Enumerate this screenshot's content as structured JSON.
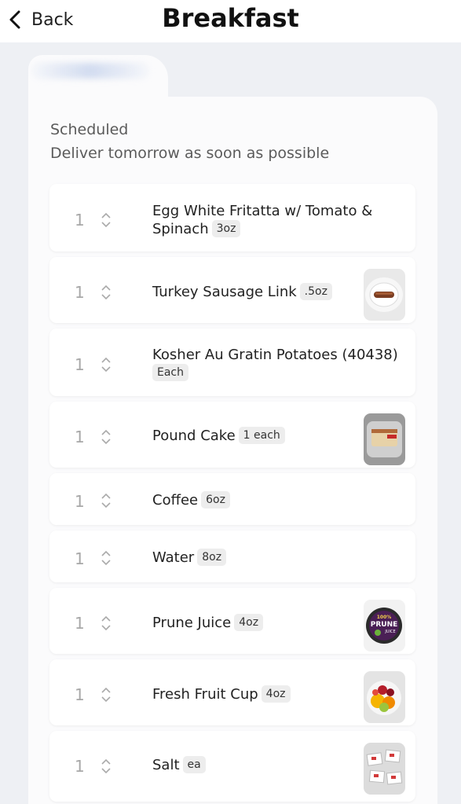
{
  "header": {
    "back_label": "Back",
    "title": "Breakfast"
  },
  "schedule": {
    "label": "Scheduled",
    "subtitle": "Deliver tomorrow as soon as possible"
  },
  "items": [
    {
      "qty": "1",
      "name": "Egg White Fritatta w/ Tomato &",
      "name2": "Spinach",
      "portion": "3oz",
      "image": null
    },
    {
      "qty": "1",
      "name": "Turkey Sausage Link",
      "portion": ".5oz",
      "image": "sausage-photo"
    },
    {
      "qty": "1",
      "name": "Kosher Au Gratin Potatoes (40438)",
      "portion": "Each",
      "image": null
    },
    {
      "qty": "1",
      "name": "Pound Cake",
      "portion": "1 each",
      "image": "pound-cake-photo"
    },
    {
      "qty": "1",
      "name": "Coffee",
      "portion": "6oz",
      "image": null
    },
    {
      "qty": "1",
      "name": "Water",
      "portion": "8oz",
      "image": null
    },
    {
      "qty": "1",
      "name": "Prune Juice",
      "portion": "4oz",
      "image": "prune-juice-photo",
      "image_label": "100% PRUNE JUICE"
    },
    {
      "qty": "1",
      "name": "Fresh Fruit Cup",
      "portion": "4oz",
      "image": "fruit-cup-photo"
    },
    {
      "qty": "1",
      "name": "Salt",
      "portion": "ea",
      "image": "salt-packets-photo"
    }
  ],
  "colors": {
    "background": "#eef0f4",
    "card": "#fbfbfc",
    "item": "#ffffff",
    "badge": "#ededed",
    "muted_text": "#5b5b5b"
  }
}
